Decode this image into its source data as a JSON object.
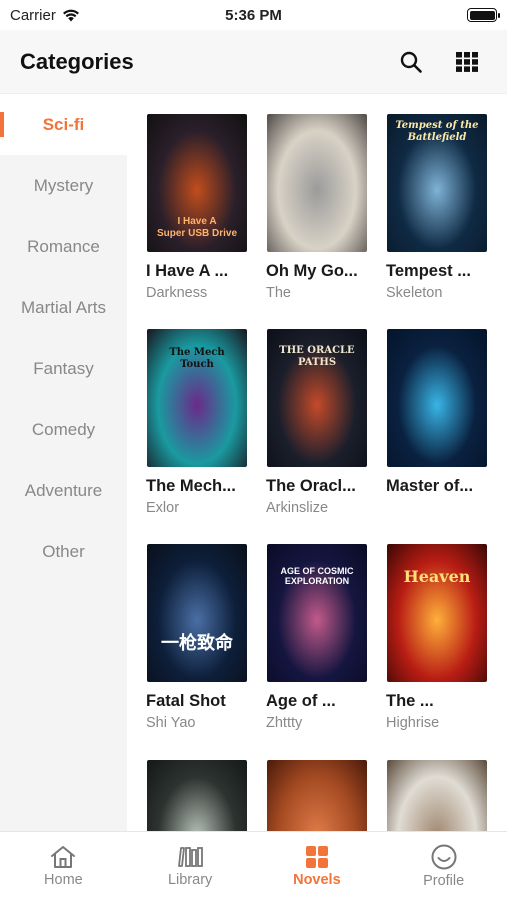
{
  "status": {
    "carrier": "Carrier",
    "time": "5:36 PM"
  },
  "header": {
    "title": "Categories"
  },
  "sidebar": {
    "items": [
      {
        "label": "Sci-fi",
        "active": true
      },
      {
        "label": "Mystery"
      },
      {
        "label": "Romance"
      },
      {
        "label": "Martial Arts"
      },
      {
        "label": "Fantasy"
      },
      {
        "label": "Comedy"
      },
      {
        "label": "Adventure"
      },
      {
        "label": "Other"
      }
    ]
  },
  "books": [
    {
      "title": "I Have A ...",
      "author": "Darkness",
      "cover_text": "I Have A\nSuper USB Drive",
      "colors": [
        "#2a1f2a",
        "#c24d1c",
        "#111"
      ]
    },
    {
      "title": "Oh My Go...",
      "author": "The",
      "cover_text": "",
      "colors": [
        "#d8d2c6",
        "#9b9b9b",
        "#4f4a47"
      ]
    },
    {
      "title": "Tempest ...",
      "author": "Skeleton",
      "cover_text": "Tempest of the Battlefield",
      "colors": [
        "#0f2a44",
        "#7fb3d5",
        "#0a1a2a"
      ]
    },
    {
      "title": "The Mech...",
      "author": "Exlor",
      "cover_text": "The Mech Touch",
      "colors": [
        "#1a9aa0",
        "#6a2a8a",
        "#18151f"
      ]
    },
    {
      "title": "The Oracl...",
      "author": "Arkinslize",
      "cover_text": "THE ORACLE PATHS",
      "colors": [
        "#1b1f2b",
        "#c44a2a",
        "#0c0f18"
      ]
    },
    {
      "title": "Master of...",
      "author": "",
      "cover_text": "",
      "colors": [
        "#0a2140",
        "#38b5e6",
        "#04142a"
      ]
    },
    {
      "title": "Fatal Shot",
      "author": "Shi Yao",
      "cover_text": "一枪致命",
      "colors": [
        "#0d1f3a",
        "#4a6fa5",
        "#0a0f1a"
      ]
    },
    {
      "title": "Age of ...",
      "author": "Zhttty",
      "cover_text": "AGE OF COSMIC EXPLORATION",
      "colors": [
        "#151640",
        "#c25a8a",
        "#0a0a25"
      ]
    },
    {
      "title": "The ...",
      "author": "Highrise",
      "cover_text": "Heaven",
      "colors": [
        "#b81d14",
        "#ffb03a",
        "#3a0705"
      ]
    },
    {
      "title": "",
      "author": "",
      "cover_text": "",
      "colors": [
        "#2d3330",
        "#b6c0b8",
        "#141816"
      ]
    },
    {
      "title": "",
      "author": "",
      "cover_text": "",
      "colors": [
        "#a44a22",
        "#e07c4a",
        "#4a1a0a"
      ]
    },
    {
      "title": "",
      "author": "",
      "cover_text": "",
      "colors": [
        "#e0dcd4",
        "#a08870",
        "#5a4a3a"
      ]
    }
  ],
  "nav": {
    "tabs": [
      {
        "label": "Home",
        "icon": "home-icon"
      },
      {
        "label": "Library",
        "icon": "library-icon"
      },
      {
        "label": "Novels",
        "icon": "novels-icon",
        "active": true
      },
      {
        "label": "Profile",
        "icon": "profile-icon"
      }
    ]
  },
  "accent_color": "#f2743a"
}
